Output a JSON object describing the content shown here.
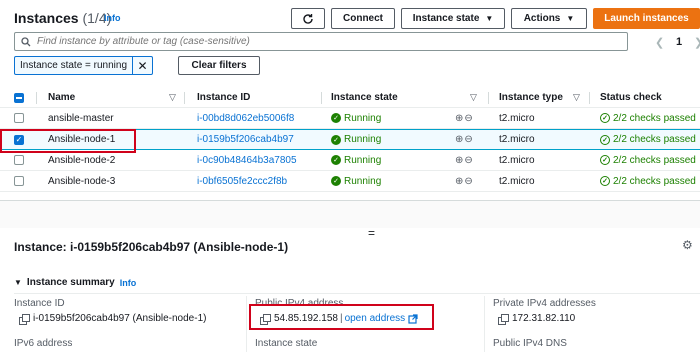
{
  "header": {
    "title": "Instances",
    "count": "(1/4)",
    "info": "Info",
    "refresh_icon": "refresh-icon",
    "connect": "Connect",
    "instance_state": "Instance state",
    "actions": "Actions",
    "launch": "Launch instances"
  },
  "search": {
    "placeholder": "Find instance by attribute or tag (case-sensitive)",
    "page": "1",
    "prev_icon": "chevron-left-icon",
    "next_icon": "chevron-right-icon"
  },
  "filter": {
    "token": "Instance state = running",
    "clear": "Clear filters"
  },
  "table": {
    "columns": [
      "Name",
      "Instance ID",
      "Instance state",
      "Instance type",
      "Status check"
    ],
    "rows": [
      {
        "name": "ansible-master",
        "id": "i-00bd8d062eb5006f8",
        "state": "Running",
        "type": "t2.micro",
        "status": "2/2 checks passed",
        "selected": false
      },
      {
        "name": "Ansible-node-1",
        "id": "i-0159b5f206cab4b97",
        "state": "Running",
        "type": "t2.micro",
        "status": "2/2 checks passed",
        "selected": true
      },
      {
        "name": "Ansible-node-2",
        "id": "i-0c90b48464b3a7805",
        "state": "Running",
        "type": "t2.micro",
        "status": "2/2 checks passed",
        "selected": false
      },
      {
        "name": "Ansible-node-3",
        "id": "i-0bf6505fe2ccc2f8b",
        "state": "Running",
        "type": "t2.micro",
        "status": "2/2 checks passed",
        "selected": false
      }
    ]
  },
  "detail": {
    "title": "Instance: i-0159b5f206cab4b97 (Ansible-node-1)",
    "summary": "Instance summary",
    "info": "Info",
    "instance_id_label": "Instance ID",
    "instance_id_value": "i-0159b5f206cab4b97 (Ansible-node-1)",
    "public_ipv4_label": "Public IPv4 address",
    "public_ipv4_value": "54.85.192.158",
    "open_address": "open address",
    "private_ipv4_label": "Private IPv4 addresses",
    "private_ipv4_value": "172.31.82.110",
    "ipv6_label": "IPv6 address",
    "instance_state_label": "Instance state",
    "public_dns_label": "Public IPv4 DNS"
  },
  "colors": {
    "accent": "#0972d3",
    "primary_button": "#ec7211",
    "success": "#1d8102",
    "highlight_box": "#d0021b"
  }
}
